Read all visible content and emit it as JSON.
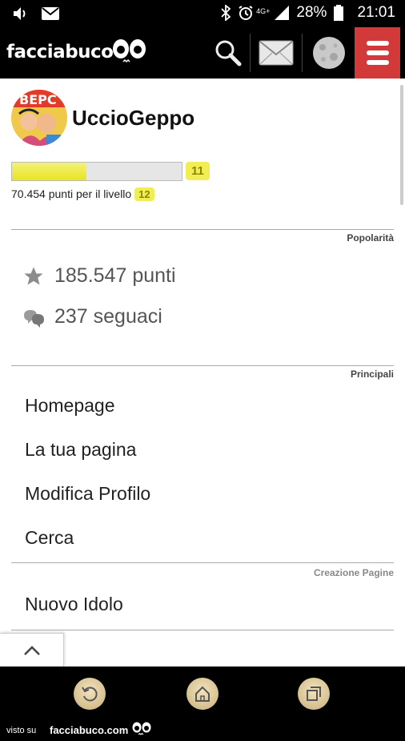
{
  "status_bar": {
    "battery_percent": "28%",
    "time": "21:01",
    "network": "4G+"
  },
  "header": {
    "logo_text": "facciabuco",
    "icons": [
      "search-icon",
      "mail-icon",
      "moon-icon",
      "menu-icon"
    ],
    "menu_color": "#d23a3a"
  },
  "profile": {
    "username": "UccioGeppo",
    "current_level": "11",
    "xp_progress_fraction": 0.44,
    "points_to_next": "70.454 punti per il livello",
    "next_level": "12"
  },
  "popularity": {
    "label": "Popolarità",
    "points": "185.547 punti",
    "followers": "237 seguaci"
  },
  "main_section": {
    "label": "Principali",
    "items": [
      "Homepage",
      "La tua pagina",
      "Modifica Profilo",
      "Cerca"
    ]
  },
  "pages_section": {
    "label": "Creazione Pagine",
    "items": [
      "Nuovo Idolo"
    ]
  },
  "footer": {
    "visto_su": "visto su",
    "site": "facciabuco.com"
  }
}
